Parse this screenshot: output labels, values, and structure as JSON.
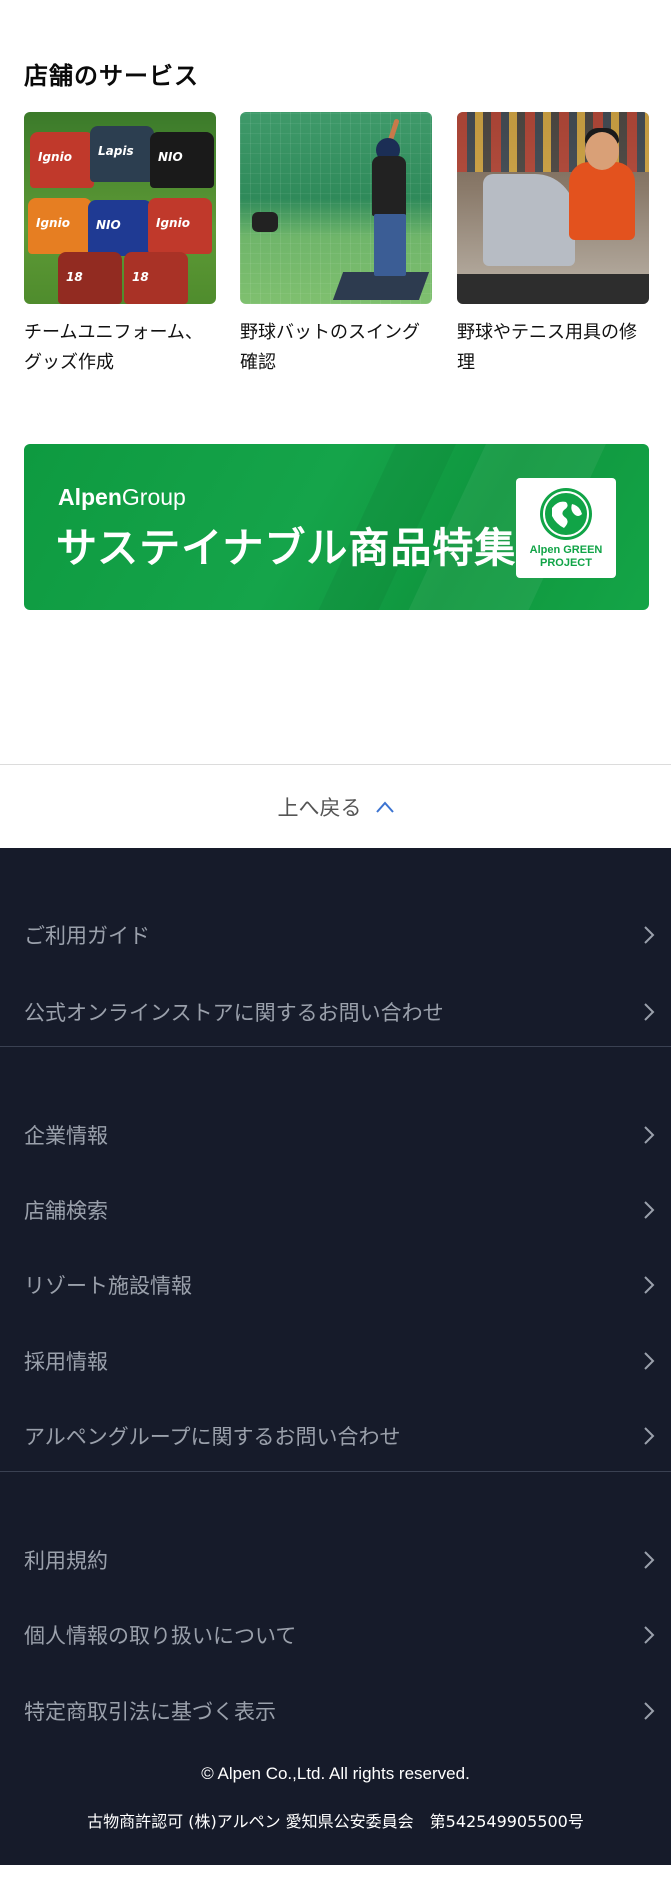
{
  "services": {
    "title": "店舗のサービス",
    "cards": [
      {
        "label": "チームユニフォーム、グッズ作成",
        "image": "team-uniforms-image"
      },
      {
        "label": "野球バットのスイング確認",
        "image": "batting-cage-image"
      },
      {
        "label": "野球やテニス用具の修理",
        "image": "equipment-repair-image"
      }
    ]
  },
  "banner": {
    "brand_bold": "Alpen",
    "brand_light": "Group",
    "title": "サステイナブル商品特集",
    "badge_line1": "Alpen GREEN",
    "badge_line2": "PROJECT",
    "color": "#11a447"
  },
  "back_to_top": {
    "label": "上へ戻る",
    "icon": "chevron-up-icon"
  },
  "footer": {
    "group1": [
      {
        "label": "ご利用ガイド"
      },
      {
        "label": "公式オンラインストアに関するお問い合わせ"
      }
    ],
    "group2": [
      {
        "label": "企業情報"
      },
      {
        "label": "店舗検索"
      },
      {
        "label": "リゾート施設情報"
      },
      {
        "label": "採用情報"
      },
      {
        "label": "アルペングループに関するお問い合わせ"
      }
    ],
    "group3": [
      {
        "label": "利用規約"
      },
      {
        "label": "個人情報の取り扱いについて"
      },
      {
        "label": "特定商取引法に基づく表示"
      }
    ],
    "copyright": "© Alpen Co.,Ltd. All rights reserved.",
    "permit": "古物商許認可 (株)アルペン 愛知県公安委員会　第542549905500号",
    "background": "#161b2a"
  }
}
